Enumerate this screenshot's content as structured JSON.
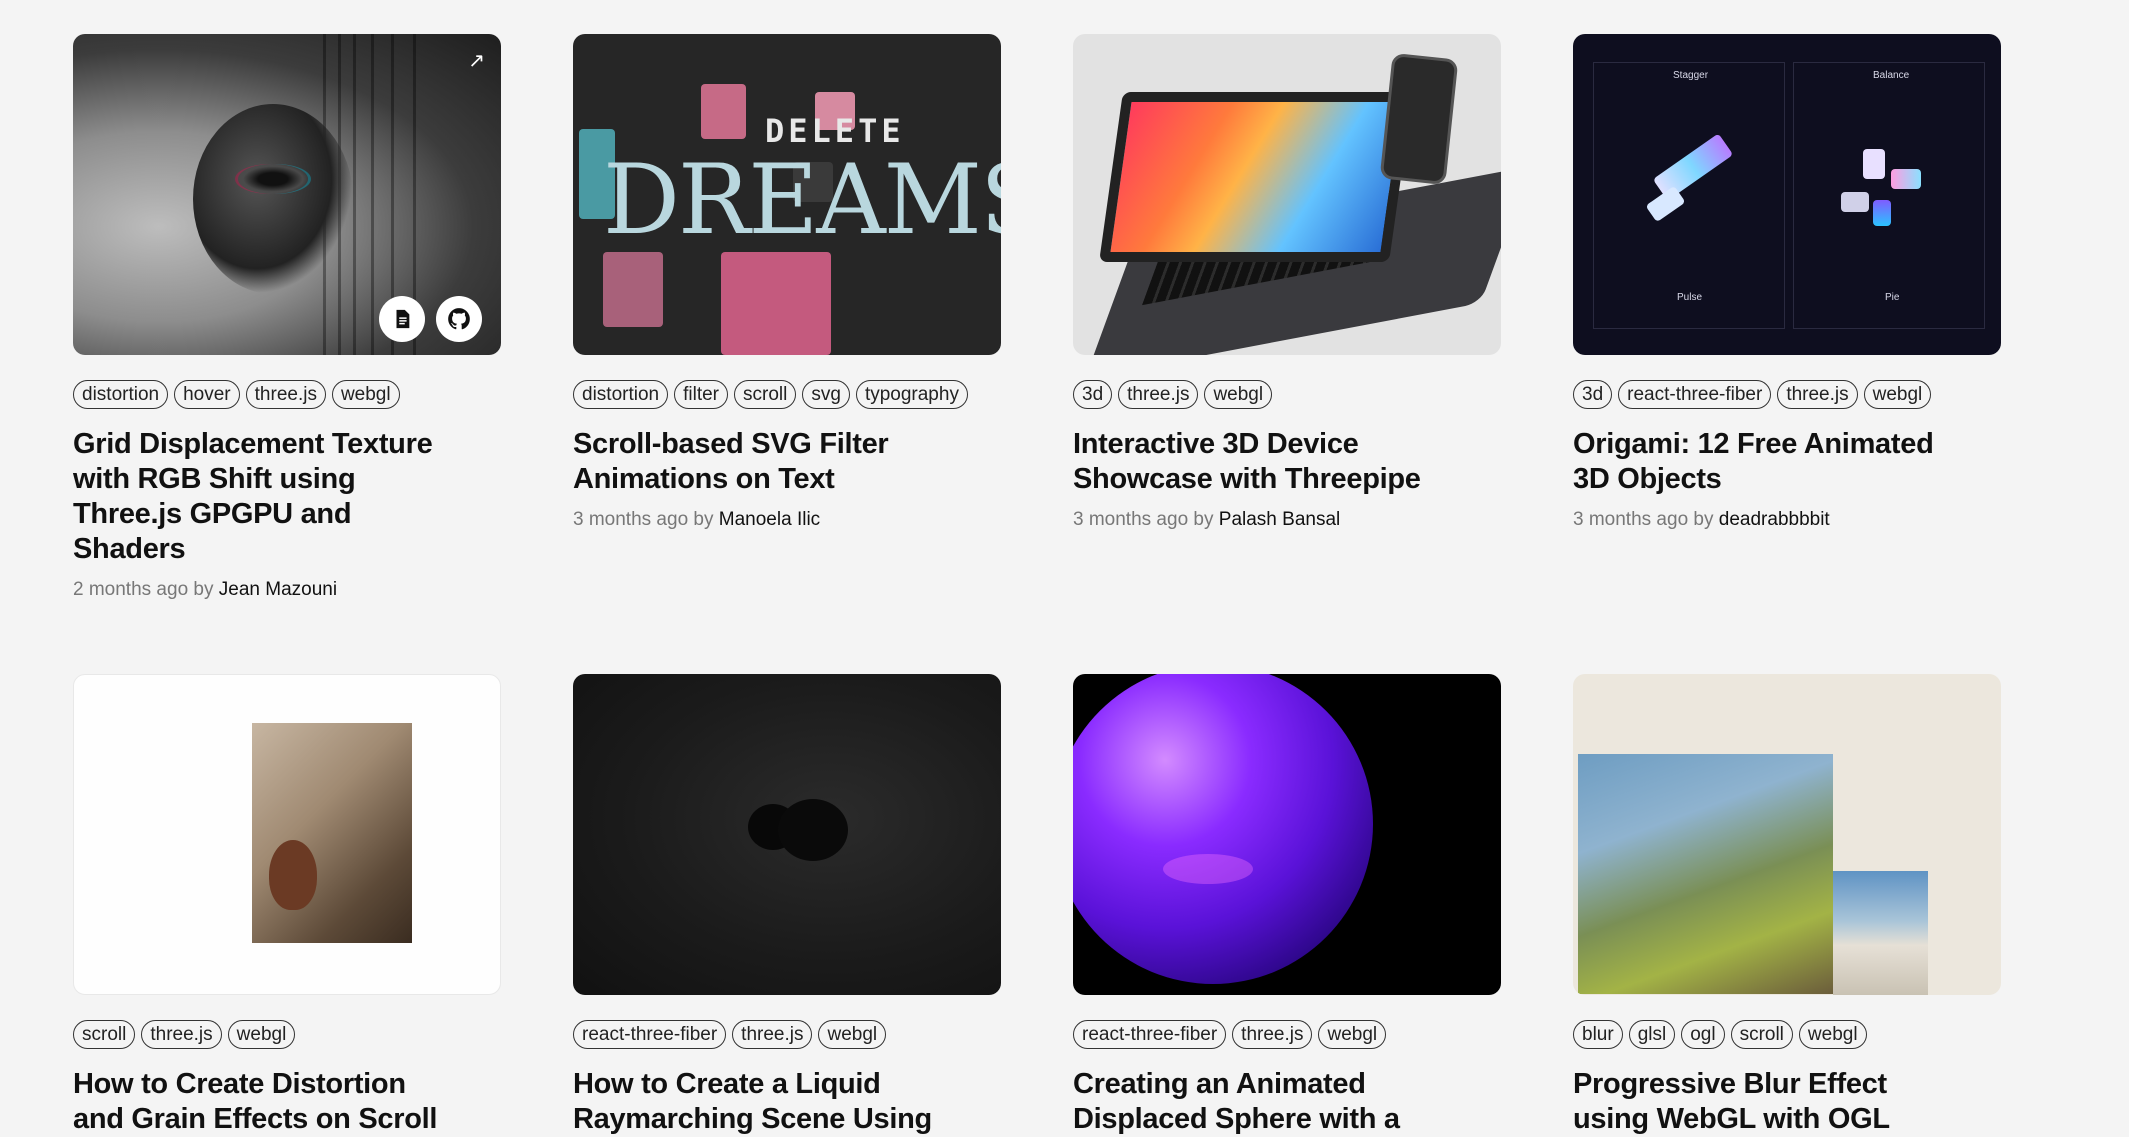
{
  "cards": [
    {
      "tags": [
        "distortion",
        "hover",
        "three.js",
        "webgl"
      ],
      "title": "Grid Displacement Texture with RGB Shift using Three.js GPGPU and Shaders",
      "time": "2 months ago",
      "by": "by",
      "author": "Jean Mazouni"
    },
    {
      "tags": [
        "distortion",
        "filter",
        "scroll",
        "svg",
        "typography"
      ],
      "title": "Scroll-based SVG Filter Animations on Text",
      "time": "3 months ago",
      "by": "by",
      "author": "Manoela Ilic",
      "thumb_text": {
        "dreams": "DREAMS",
        "delete": "DELETE"
      }
    },
    {
      "tags": [
        "3d",
        "three.js",
        "webgl"
      ],
      "title": "Interactive 3D Device Showcase with Threepipe",
      "time": "3 months ago",
      "by": "by",
      "author": "Palash Bansal"
    },
    {
      "tags": [
        "3d",
        "react-three-fiber",
        "three.js",
        "webgl"
      ],
      "title": "Origami: 12 Free Animated 3D Objects",
      "time": "3 months ago",
      "by": "by",
      "author": "deadrabbbbit",
      "thumb_text": {
        "stagger": "Stagger",
        "balance": "Balance",
        "pulse": "Pulse",
        "pie": "Pie"
      }
    },
    {
      "tags": [
        "scroll",
        "three.js",
        "webgl"
      ],
      "title": "How to Create Distortion and Grain Effects on Scroll"
    },
    {
      "tags": [
        "react-three-fiber",
        "three.js",
        "webgl"
      ],
      "title": "How to Create a Liquid Raymarching Scene Using"
    },
    {
      "tags": [
        "react-three-fiber",
        "three.js",
        "webgl"
      ],
      "title": "Creating an Animated Displaced Sphere with a"
    },
    {
      "tags": [
        "blur",
        "glsl",
        "ogl",
        "scroll",
        "webgl"
      ],
      "title": "Progressive Blur Effect using WebGL with OGL"
    }
  ],
  "icons": {
    "doc": "document-icon",
    "github": "github-icon",
    "arrow": "external-link-arrow-icon"
  }
}
